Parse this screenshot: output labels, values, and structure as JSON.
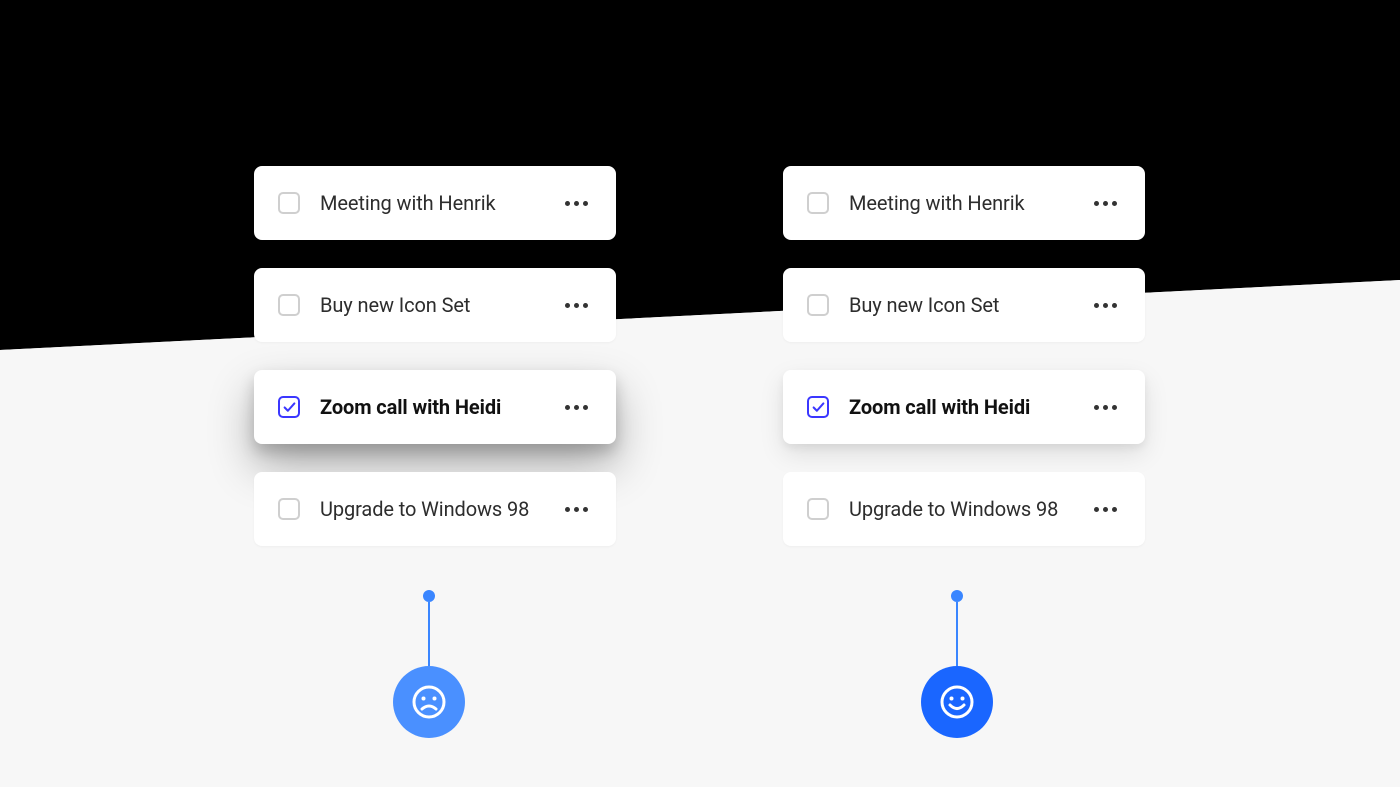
{
  "columns": {
    "left": {
      "indicator_mood": "sad",
      "shadow_style": "heavy",
      "tasks": [
        {
          "label": "Meeting with Henrik",
          "checked": false,
          "selected": false
        },
        {
          "label": "Buy new Icon Set",
          "checked": false,
          "selected": false
        },
        {
          "label": "Zoom call with Heidi",
          "checked": true,
          "selected": true
        },
        {
          "label": "Upgrade to Windows 98",
          "checked": false,
          "selected": false
        }
      ]
    },
    "right": {
      "indicator_mood": "happy",
      "shadow_style": "light",
      "tasks": [
        {
          "label": "Meeting with Henrik",
          "checked": false,
          "selected": false
        },
        {
          "label": "Buy new Icon Set",
          "checked": false,
          "selected": false
        },
        {
          "label": "Zoom call with Heidi",
          "checked": true,
          "selected": true
        },
        {
          "label": "Upgrade to Windows 98",
          "checked": false,
          "selected": false
        }
      ]
    }
  },
  "colors": {
    "accent": "#3B37FF",
    "indicator": "#3a86ff"
  }
}
